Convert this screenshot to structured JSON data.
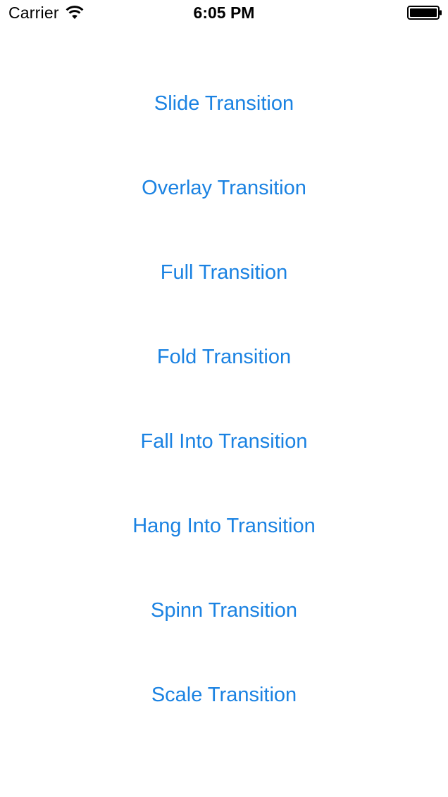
{
  "status_bar": {
    "carrier": "Carrier",
    "time": "6:05 PM",
    "wifi_icon": "wifi-icon",
    "battery_icon": "battery-icon"
  },
  "colors": {
    "accent": "#1a82e2",
    "background": "#ffffff",
    "status_text": "#000000"
  },
  "transitions": [
    {
      "label": "Slide Transition"
    },
    {
      "label": "Overlay Transition"
    },
    {
      "label": "Full Transition"
    },
    {
      "label": "Fold Transition"
    },
    {
      "label": "Fall Into Transition"
    },
    {
      "label": "Hang Into Transition"
    },
    {
      "label": "Spinn Transition"
    },
    {
      "label": "Scale Transition"
    }
  ]
}
